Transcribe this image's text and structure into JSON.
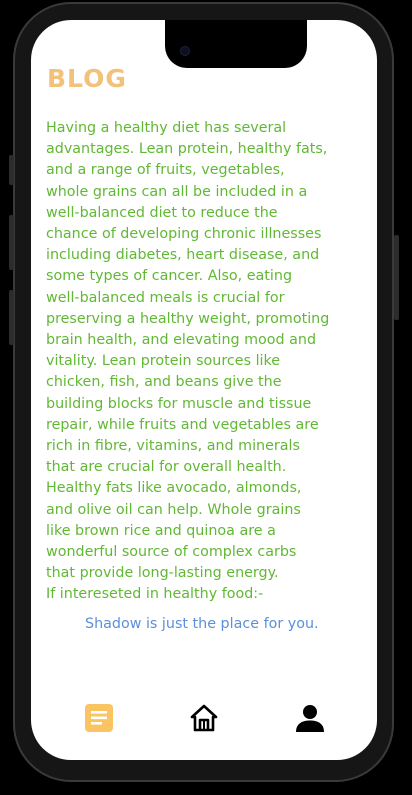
{
  "header": {
    "title": "BLOG"
  },
  "article": {
    "body": "Having a healthy diet has several\nadvantages. Lean protein, healthy fats,\nand a range of fruits, vegetables,\nwhole grains can all be included in a\nwell-balanced diet to reduce the\nchance of developing chronic illnesses\nincluding diabetes, heart disease, and\nsome types of cancer. Also, eating\nwell-balanced meals is crucial for\npreserving a healthy weight, promoting\nbrain health, and elevating mood and\nvitality. Lean protein sources like\nchicken, fish, and beans give the\nbuilding blocks for muscle and tissue\nrepair, while fruits and vegetables are\nrich in fibre, vitamins, and minerals\nthat are crucial for overall health.\nHealthy fats like avocado, almonds,\nand olive oil can help. Whole grains\nlike brown rice and quinoa are a\nwonderful source of complex carbs\nthat provide long-lasting energy.",
    "cta_lead": "If intereseted in healthy food:-",
    "cta_highlight": "Shadow is just the place for you."
  },
  "bottom_nav": {
    "items": [
      {
        "icon": "article-icon",
        "active": true
      },
      {
        "icon": "home-icon",
        "active": false
      },
      {
        "icon": "person-icon",
        "active": false
      }
    ]
  },
  "colors": {
    "title": "#f3c27a",
    "body_text": "#61b834",
    "highlight_text": "#5b8fd8",
    "active_nav_icon": "#fbc463",
    "inactive_nav_icon": "#000000",
    "screen_background": "#ffffff",
    "frame": "#161616"
  }
}
